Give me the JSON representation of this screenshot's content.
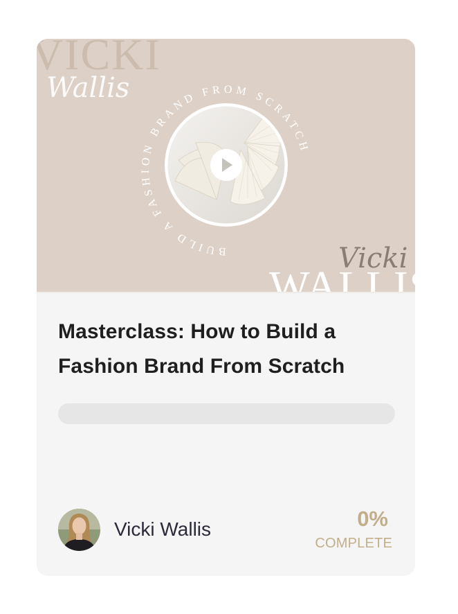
{
  "course": {
    "title": "Masterclass: How to Build a Fashion Brand From Scratch",
    "progress_fraction": 0,
    "progress_percent_text": "0%",
    "complete_label": "COMPLETE"
  },
  "thumbnail": {
    "brand_top_caps": "VICKI",
    "brand_top_script": "Wallis",
    "brand_bottom_script": "Vicki",
    "brand_bottom_caps": "WALLIS",
    "circle_text": "BUILD A FASHION BRAND FROM SCRATCH",
    "play_icon": "play-icon",
    "background_color": "#ddd0c6"
  },
  "author": {
    "name": "Vicki Wallis",
    "avatar_icon": "author-avatar"
  },
  "colors": {
    "accent": "#c3ae8b",
    "card_bg": "#f5f5f5",
    "progress_track": "#e6e6e6",
    "title_text": "#1f1f1f"
  }
}
